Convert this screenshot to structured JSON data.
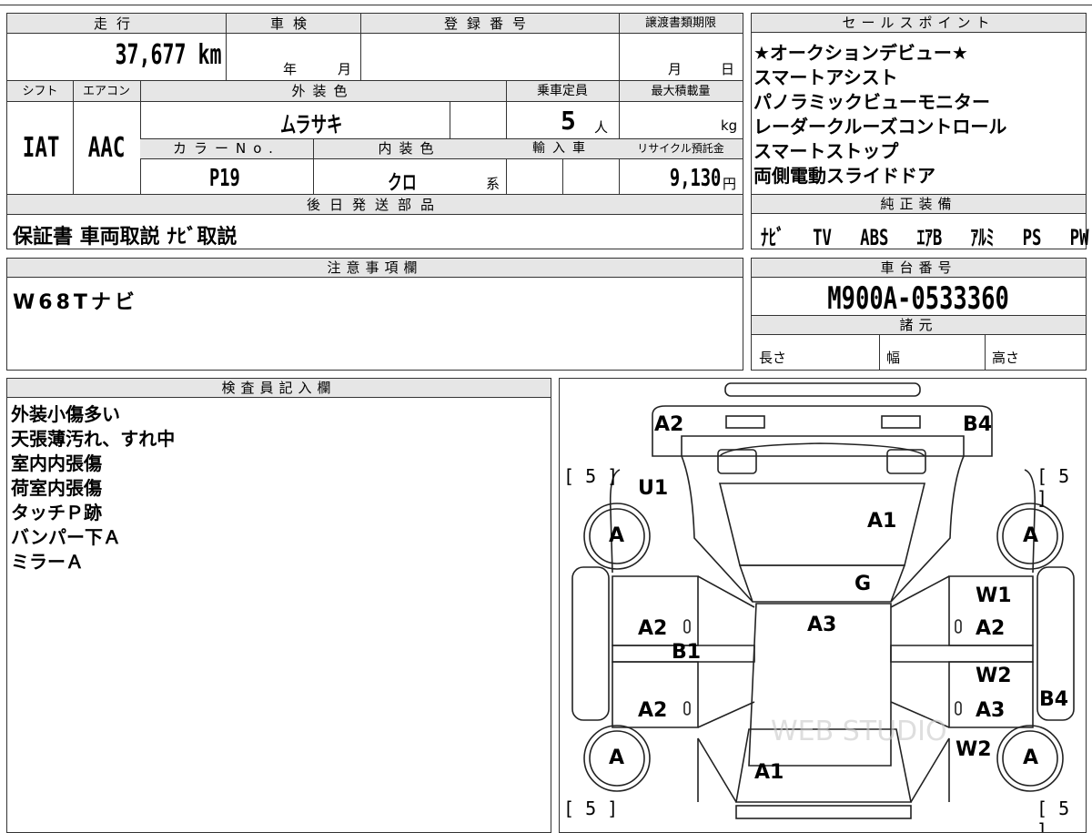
{
  "top_table": {
    "mileage": {
      "label": "走行",
      "value": "37,677 km"
    },
    "inspection": {
      "label": "車検",
      "year_unit": "年",
      "month_unit": "月"
    },
    "registration": {
      "label": "登録番号",
      "value": ""
    },
    "transfer_deadline": {
      "label": "譲渡書類期限",
      "month_unit": "月",
      "day_unit": "日"
    },
    "shift": {
      "label": "シフト",
      "value": "IAT"
    },
    "aircon": {
      "label": "エアコン",
      "value": "AAC"
    },
    "exterior_color": {
      "label": "外装色",
      "value": "ムラサキ"
    },
    "capacity": {
      "label": "乗車定員",
      "value": "5",
      "unit": "人"
    },
    "max_load": {
      "label": "最大積載量",
      "value": "",
      "unit": "kg"
    },
    "color_no": {
      "label": "カラーNo.",
      "value": "P19"
    },
    "interior_color": {
      "label": "内装色",
      "value": "クロ",
      "suffix": "系"
    },
    "import": {
      "label": "輸入車"
    },
    "recycle": {
      "label": "リサイクル預託金",
      "value": "9,130",
      "unit": "円"
    },
    "later_parts": {
      "label": "後日発送部品",
      "value": "保証書 車両取説 ﾅﾋﾞ取説"
    }
  },
  "sales_points": {
    "label": "セールスポイント",
    "items": [
      "★オークションデビュー★",
      "スマートアシスト",
      "パノラミックビューモニター",
      "レーダークルーズコントロール",
      "スマートストップ",
      "両側電動スライドドア"
    ]
  },
  "genuine_equipment": {
    "label": "純正装備",
    "items": [
      "ﾅﾋﾞ",
      "TV",
      "ABS",
      "ｴｱB",
      "ｱﾙﾐ",
      "PS",
      "PW"
    ]
  },
  "notes": {
    "label": "注意事項欄",
    "value": "W68Tナビ"
  },
  "chassis": {
    "label": "車台番号",
    "value": "M900A-0533360"
  },
  "specs": {
    "label": "諸元",
    "length": "長さ",
    "width": "幅",
    "height": "高さ"
  },
  "inspector": {
    "label": "検査員記入欄",
    "lines": [
      "外装小傷多い",
      "天張薄汚れ、すれ中",
      "室内内張傷",
      "荷室内張傷",
      "タッチＰ跡",
      "バンパー下Ａ",
      "ミラーＡ"
    ]
  },
  "diagram": {
    "tire_bracket": "[ 5 ]",
    "tire_label": "A",
    "marks": [
      "A2",
      "B4",
      "U1",
      "A1",
      "G",
      "A3",
      "W1",
      "A2",
      "B1",
      "A2",
      "W2",
      "A3",
      "B4",
      "A2",
      "W2",
      "A1"
    ],
    "watermark": "WEB STUDIO"
  }
}
